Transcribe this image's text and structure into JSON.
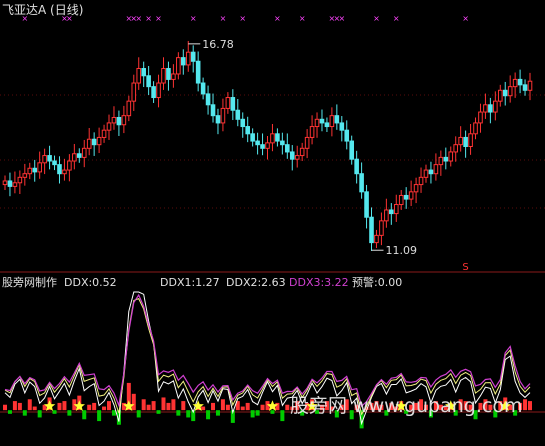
{
  "main_title": "飞亚达A (日线)",
  "indicator_name": "股旁网制作",
  "indicator_values": [
    {
      "label": "DDX:0.52",
      "color": "#e0e0e0"
    },
    {
      "label": "DDX1:1.27",
      "color": "#e0e0e0"
    },
    {
      "label": "DDX2:2.63",
      "color": "#e0e0e0"
    },
    {
      "label": "DDX3:3.22",
      "color": "#d040d0"
    },
    {
      "label": "预警:0.00",
      "color": "#e0e0e0"
    }
  ],
  "watermark": "股旁网 www.gupang.com",
  "s_marker": "S",
  "colors": {
    "up": "#ff3333",
    "down": "#55e8ee",
    "marks": "#ff44ff",
    "star": "#ffff33",
    "neg_bar": "#00cc00"
  },
  "chart_data": {
    "type": "candlestick",
    "annotations": [
      {
        "label": "16.78",
        "value": 16.78,
        "kind": "high"
      },
      {
        "label": "11.09",
        "value": 11.09,
        "kind": "low"
      }
    ],
    "price_range": [
      10.6,
      17.3
    ],
    "closes": [
      13.0,
      12.85,
      12.95,
      13.1,
      13.2,
      13.35,
      13.25,
      13.5,
      13.7,
      13.55,
      13.45,
      13.2,
      13.3,
      13.55,
      13.75,
      13.65,
      13.9,
      14.15,
      14.0,
      14.2,
      14.4,
      14.6,
      14.75,
      14.55,
      14.8,
      15.2,
      15.7,
      16.1,
      15.9,
      15.6,
      15.3,
      15.7,
      16.1,
      15.8,
      15.95,
      16.4,
      16.2,
      16.55,
      16.3,
      15.7,
      15.4,
      15.1,
      14.8,
      14.6,
      15.0,
      15.3,
      14.95,
      14.7,
      14.5,
      14.3,
      14.1,
      14.0,
      13.9,
      14.05,
      14.3,
      14.1,
      14.0,
      13.8,
      13.6,
      13.7,
      13.9,
      14.2,
      14.5,
      14.7,
      14.6,
      14.5,
      14.8,
      14.6,
      14.4,
      14.1,
      13.6,
      13.2,
      12.7,
      12.0,
      11.3,
      11.5,
      11.9,
      12.2,
      12.1,
      12.35,
      12.6,
      12.5,
      12.7,
      12.9,
      13.1,
      13.3,
      13.2,
      13.45,
      13.65,
      13.55,
      13.8,
      14.0,
      14.2,
      13.95,
      14.3,
      14.6,
      14.9,
      15.1,
      14.9,
      15.2,
      15.5,
      15.35,
      15.6,
      15.8,
      15.65,
      15.5,
      15.75
    ],
    "ddx_panel": {
      "range": [
        -1.2,
        6.5
      ],
      "bars": [
        0.3,
        -0.2,
        0.5,
        0.4,
        -0.3,
        0.6,
        0.2,
        -0.4,
        0.3,
        0.7,
        -0.2,
        0.4,
        0.5,
        -0.3,
        0.6,
        0.8,
        -0.5,
        0.3,
        0.4,
        -0.6,
        0.2,
        0.5,
        -0.3,
        -0.8,
        0.4,
        1.5,
        0.9,
        -0.4,
        0.6,
        0.3,
        0.5,
        -0.2,
        0.7,
        0.4,
        0.6,
        -0.3,
        0.5,
        -0.4,
        -0.6,
        0.3,
        0.2,
        -0.5,
        0.4,
        -0.3,
        0.6,
        0.3,
        -0.7,
        0.5,
        0.2,
        0.4,
        -0.4,
        -0.3,
        0.3,
        0.5,
        -0.2,
        0.4,
        -0.6,
        0.3,
        0.2,
        0.5,
        -0.3,
        0.4,
        0.6,
        -0.2,
        0.3,
        0.5,
        0.2,
        -0.4,
        0.3,
        0.6,
        -0.5,
        0.3,
        -1.0,
        0.2,
        0.4,
        0.5,
        0.3,
        -0.3,
        0.4,
        0.2,
        0.5,
        -0.2,
        0.3,
        0.4,
        0.6,
        0.3,
        -0.4,
        0.5,
        0.3,
        0.2,
        0.4,
        -0.3,
        0.6,
        0.5,
        0.3,
        -0.5,
        0.4,
        0.6,
        0.3,
        -0.4,
        0.5,
        0.7,
        0.3,
        -0.3,
        0.4,
        0.6,
        0.5
      ],
      "stars_at": [
        9,
        15,
        25,
        39,
        54,
        62,
        80,
        90,
        101
      ]
    }
  }
}
